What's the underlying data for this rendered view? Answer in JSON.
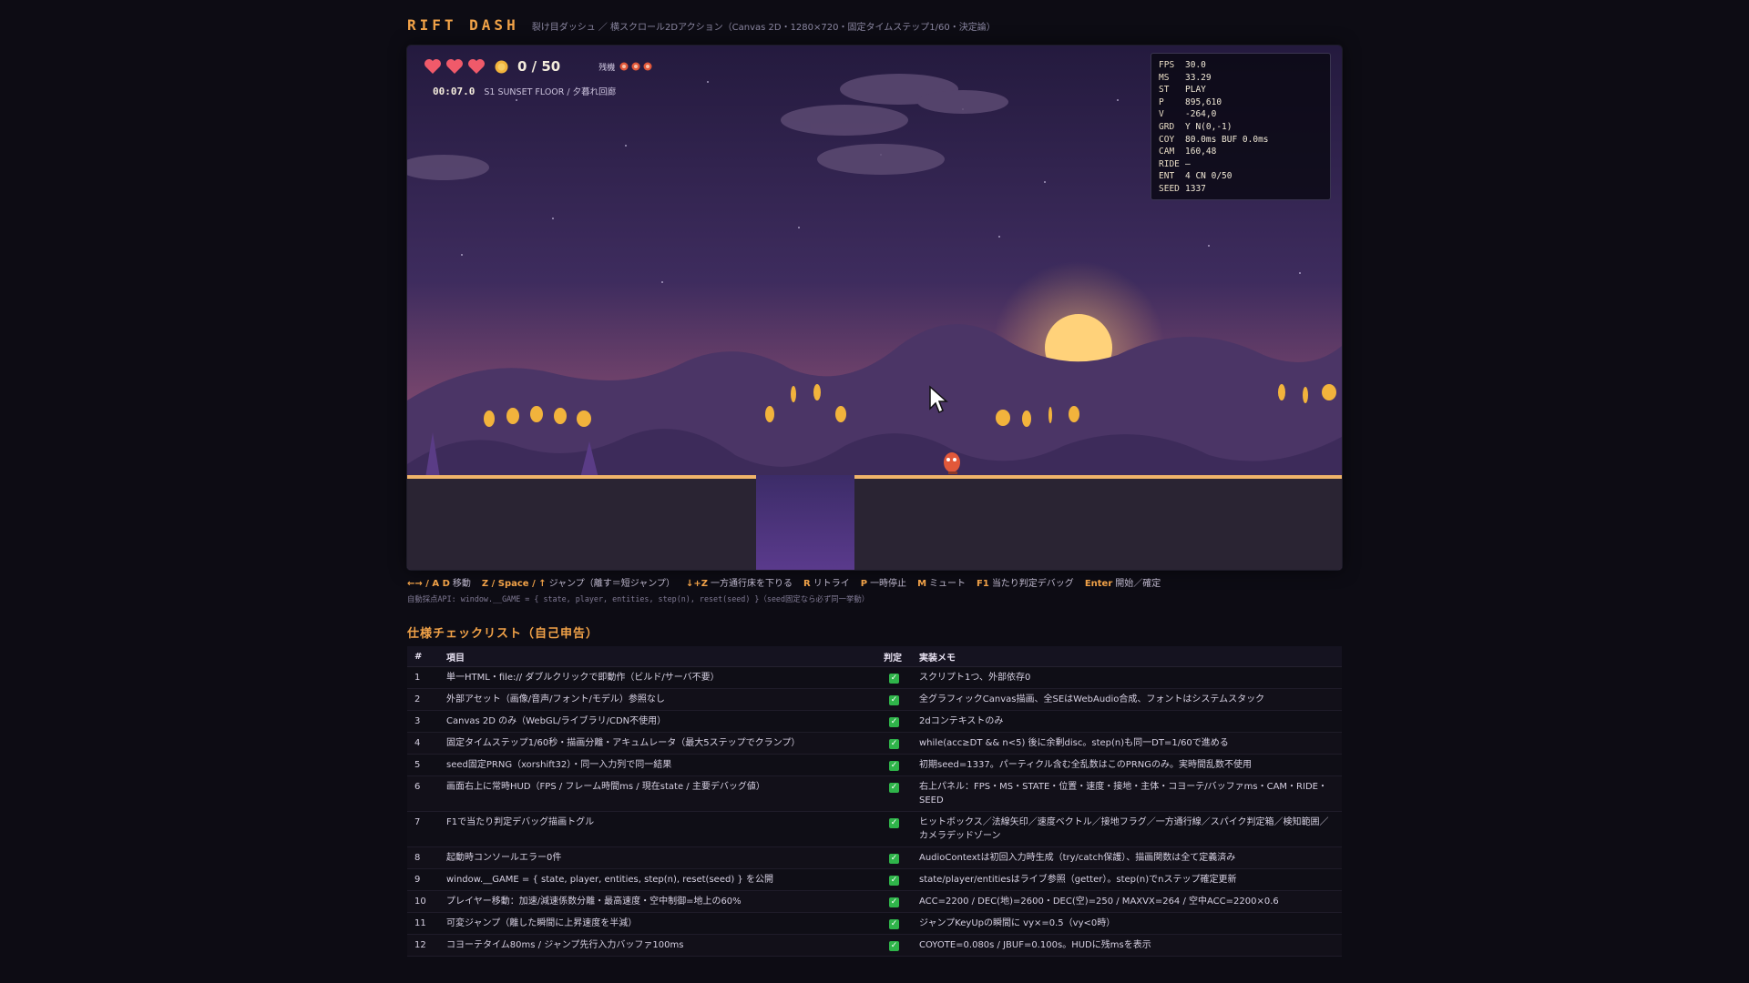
{
  "header": {
    "logo": "RIFT DASH",
    "subtitle": "裂け目ダッシュ ／ 横スクロール2Dアクション（Canvas 2D・1280×720・固定タイムステップ1/60・決定論）"
  },
  "hud": {
    "hearts": 3,
    "coins": "0 / 50",
    "lives_label": "残機",
    "lives": 3,
    "timer": "00:07.0",
    "stage": "S1 SUNSET FLOOR / 夕暮れ回廊"
  },
  "debug": {
    "rows": [
      {
        "k": "FPS",
        "v": "30.0"
      },
      {
        "k": "MS",
        "v": "33.29"
      },
      {
        "k": "ST",
        "v": "PLAY"
      },
      {
        "k": "P",
        "v": "895,610"
      },
      {
        "k": "V",
        "v": "-264,0"
      },
      {
        "k": "GRD",
        "v": "Y N(0,-1)"
      },
      {
        "k": "COY",
        "v": "80.0ms BUF 0.0ms"
      },
      {
        "k": "CAM",
        "v": "160,48"
      },
      {
        "k": "RIDE",
        "v": "–"
      },
      {
        "k": "ENT",
        "v": "4 CN 0/50"
      },
      {
        "k": "SEED",
        "v": "1337"
      }
    ]
  },
  "controls": [
    {
      "key": "←→ / A D",
      "label": "移動"
    },
    {
      "key": "Z / Space / ↑",
      "label": "ジャンプ（離す＝短ジャンプ）"
    },
    {
      "key": "↓+Z",
      "label": "一方通行床を下りる"
    },
    {
      "key": "R",
      "label": "リトライ"
    },
    {
      "key": "P",
      "label": "一時停止"
    },
    {
      "key": "M",
      "label": "ミュート"
    },
    {
      "key": "F1",
      "label": "当たり判定デバッグ"
    },
    {
      "key": "Enter",
      "label": "開始／確定"
    }
  ],
  "api_note": "自動採点API: window.__GAME = { state, player, entities, step(n), reset(seed) }（seed固定なら必ず同一挙動）",
  "checklist": {
    "title": "仕様チェックリスト（自己申告）",
    "headers": [
      "#",
      "項目",
      "判定",
      "実装メモ"
    ],
    "rows": [
      {
        "n": "1",
        "item": "単一HTML・file:// ダブルクリックで即動作（ビルド/サーバ不要）",
        "memo": "スクリプト1つ、外部依存0"
      },
      {
        "n": "2",
        "item": "外部アセット（画像/音声/フォント/モデル）参照なし",
        "memo": "全グラフィックCanvas描画、全SEはWebAudio合成、フォントはシステムスタック"
      },
      {
        "n": "3",
        "item": "Canvas 2D のみ（WebGL/ライブラリ/CDN不使用）",
        "memo": "2dコンテキストのみ"
      },
      {
        "n": "4",
        "item": "固定タイムステップ1/60秒・描画分離・アキュムレータ（最大5ステップでクランプ）",
        "memo": "while(acc≥DT && n<5) 後に余剰disc。step(n)も同一DT=1/60で進める"
      },
      {
        "n": "5",
        "item": "seed固定PRNG（xorshift32）・同一入力列で同一結果",
        "memo": "初期seed=1337。パーティクル含む全乱数はこのPRNGのみ。実時間乱数不使用"
      },
      {
        "n": "6",
        "item": "画面右上に常時HUD（FPS / フレーム時間ms / 現在state / 主要デバッグ値）",
        "memo": "右上パネル：FPS・MS・STATE・位置・速度・接地・主体・コヨーテ/バッファms・CAM・RIDE・SEED"
      },
      {
        "n": "7",
        "item": "F1で当たり判定デバッグ描画トグル",
        "memo": "ヒットボックス／法線矢印／速度ベクトル／接地フラグ／一方通行線／スパイク判定箱／検知範囲／カメラデッドゾーン"
      },
      {
        "n": "8",
        "item": "起動時コンソールエラー0件",
        "memo": "AudioContextは初回入力時生成（try/catch保護）、描画関数は全て定義済み"
      },
      {
        "n": "9",
        "item": "window.__GAME = { state, player, entities, step(n), reset(seed) } を公開",
        "memo": "state/player/entitiesはライブ参照（getter）。step(n)でnステップ確定更新"
      },
      {
        "n": "10",
        "item": "プレイヤー移動：加速/減速係数分離・最高速度・空中制御=地上の60%",
        "memo": "ACC=2200 / DEC(地)=2600・DEC(空)=250 / MAXVX=264 / 空中ACC=2200×0.6"
      },
      {
        "n": "11",
        "item": "可変ジャンプ（離した瞬間に上昇速度を半減）",
        "memo": "ジャンプKeyUpの瞬間に vy×=0.5（vy<0時）"
      },
      {
        "n": "12",
        "item": "コヨーテタイム80ms / ジャンプ先行入力バッファ100ms",
        "memo": "COYOTE=0.080s / JBUF=0.100s。HUDに残msを表示"
      }
    ]
  },
  "colors": {
    "accent": "#f1a248",
    "background": "#0d0c14",
    "check": "#2fb44a"
  }
}
